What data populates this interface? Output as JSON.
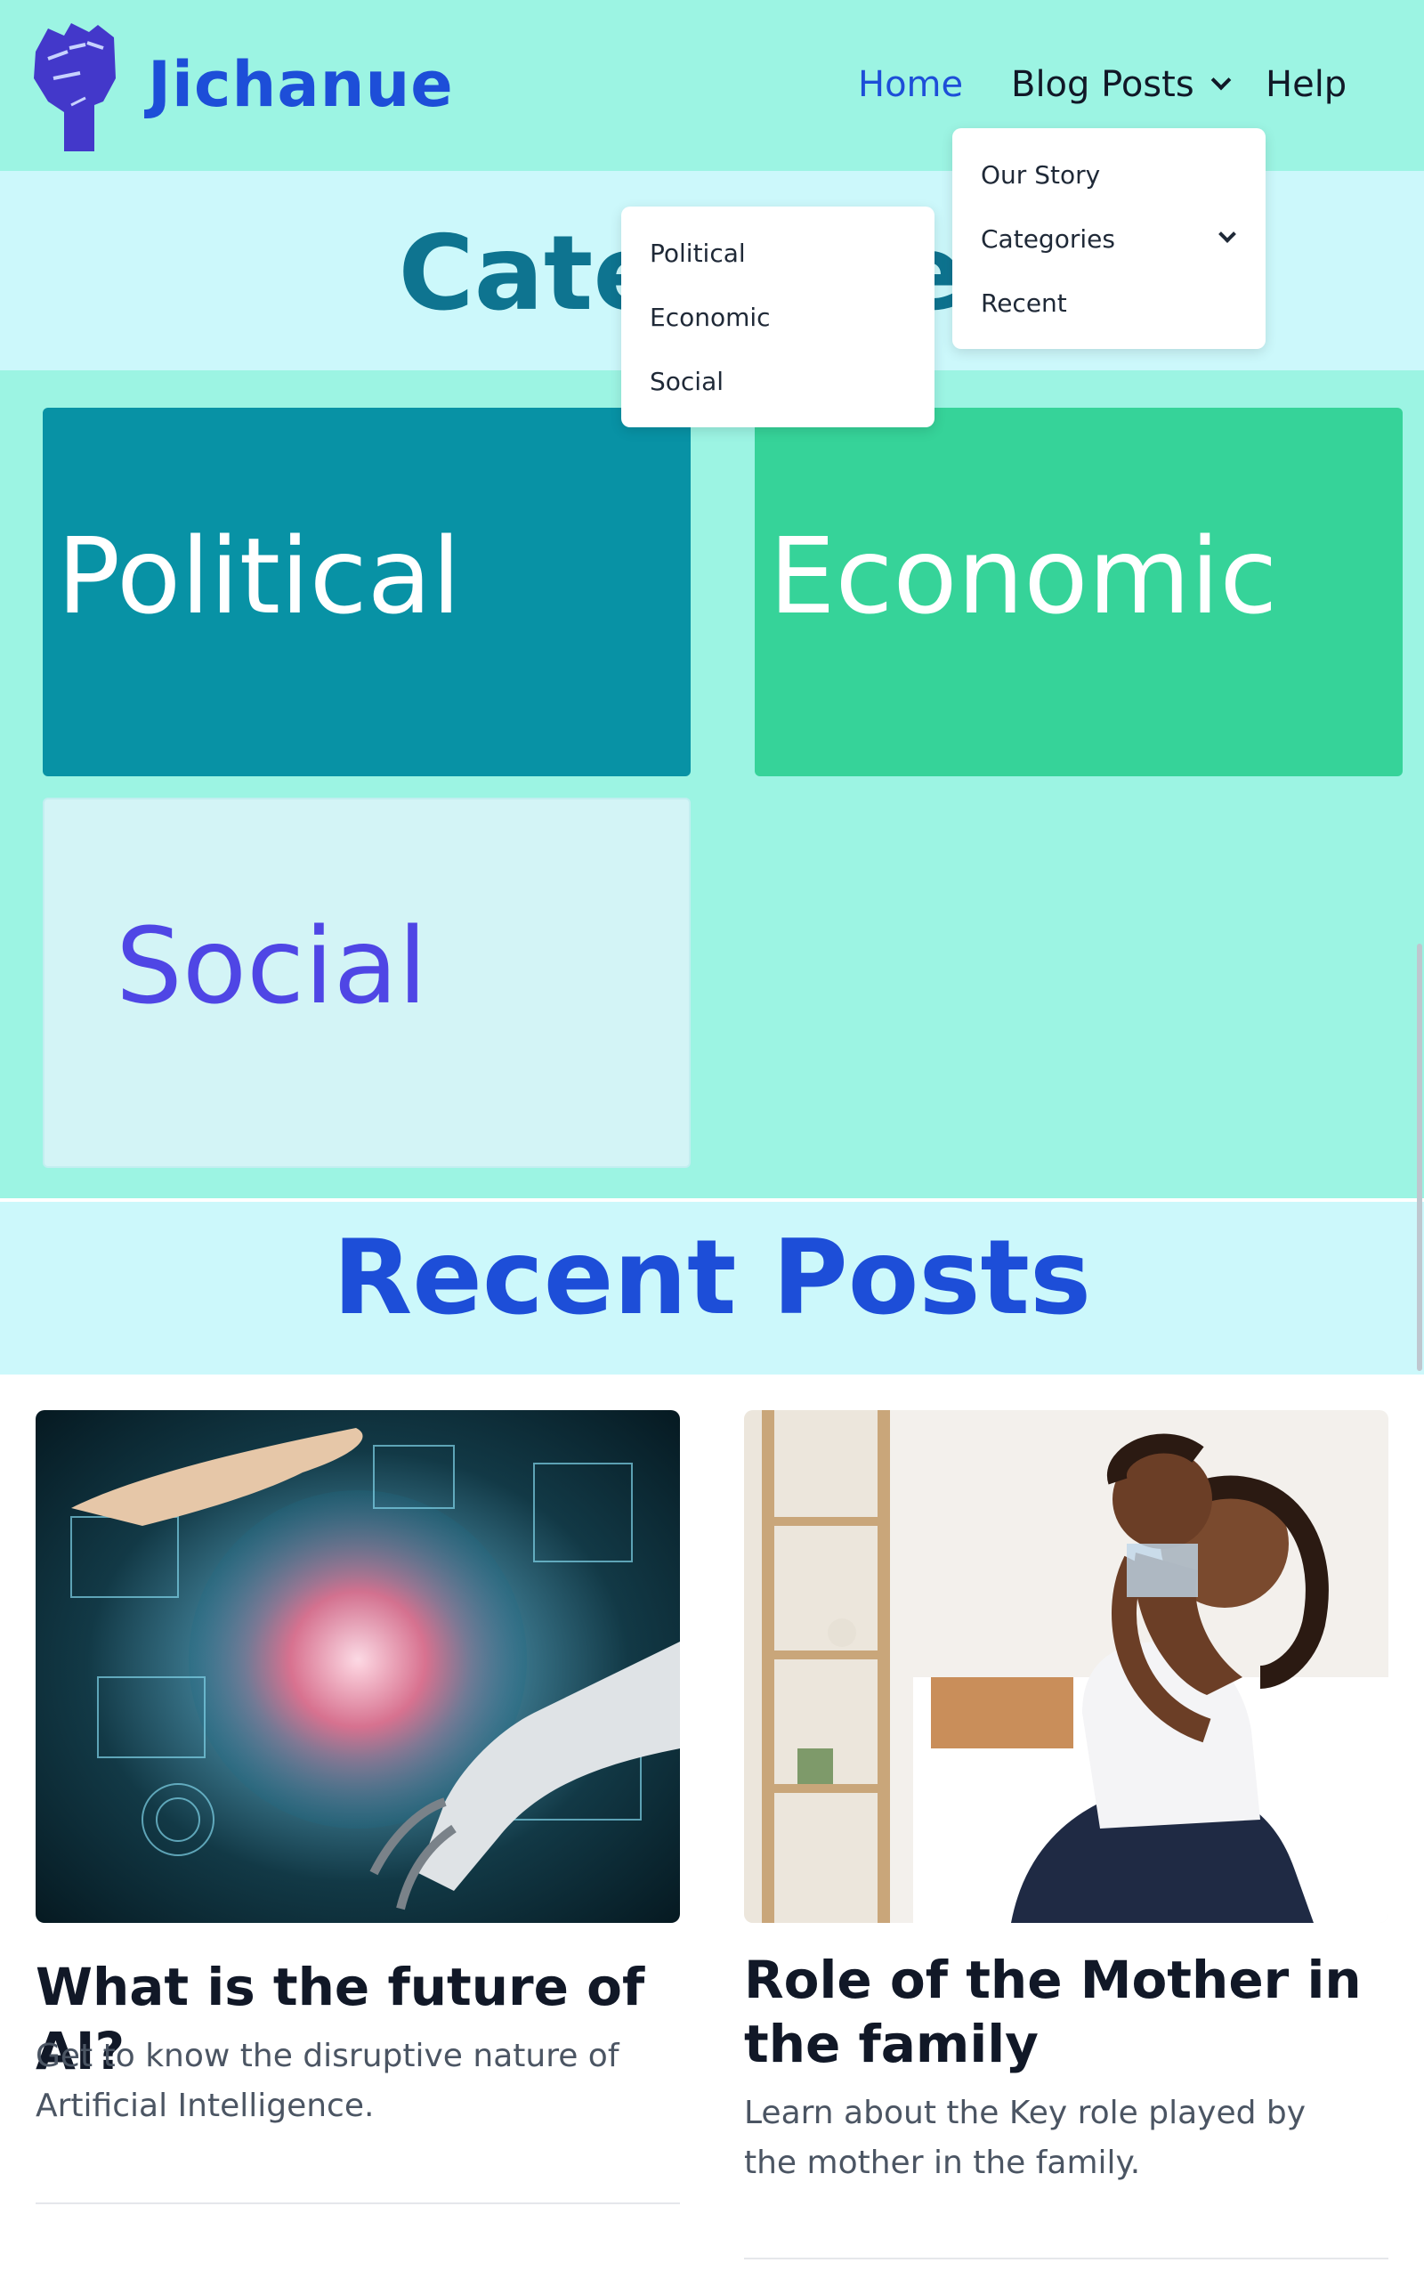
{
  "header": {
    "brand": "Jichanue",
    "logo_icon": "raised-fist-icon",
    "nav": {
      "home": "Home",
      "blog_posts": "Blog Posts",
      "help": "Help"
    }
  },
  "blog_menu": {
    "items": [
      "Our Story",
      "Categories",
      "Recent"
    ]
  },
  "categories_menu": {
    "items": [
      "Political",
      "Economic",
      "Social"
    ]
  },
  "categories_section": {
    "title": "Categories",
    "cards": [
      "Political",
      "Economic",
      "Social"
    ]
  },
  "recent_section": {
    "title": "Recent Posts"
  },
  "posts": [
    {
      "title": "What is the future of AI?",
      "description": "Get to know the disruptive nature of Artificial Intelligence.",
      "image": "robot-hand-ai-image"
    },
    {
      "title": "Role of the Mother in the family",
      "description": "Learn about the Key role played by the mother in the family.",
      "image": "mother-and-child-image"
    }
  ],
  "colors": {
    "header_bg": "#9cf4e3",
    "brand": "#1d4ed8",
    "political_card": "#0892a5",
    "economic_card": "#36d399",
    "social_card": "#d3f4f6"
  }
}
